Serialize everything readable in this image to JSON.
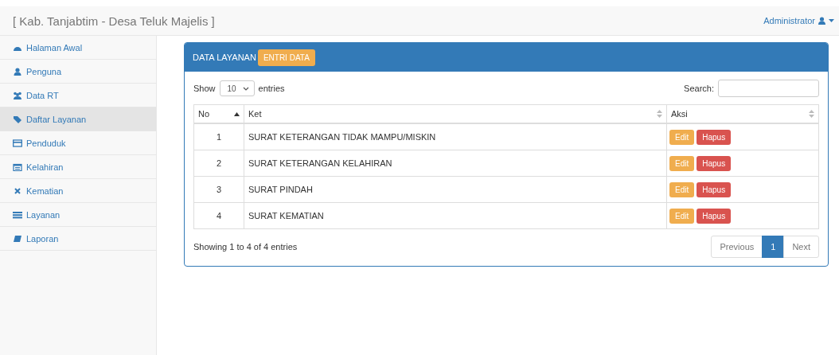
{
  "brand": "[ Kab. Tanjabtim - Desa Teluk Majelis ]",
  "user": {
    "name": "Administrator"
  },
  "sidebar": {
    "items": [
      {
        "label": "Halaman Awal",
        "selected": false
      },
      {
        "label": "Penguna",
        "selected": false
      },
      {
        "label": "Data RT",
        "selected": false
      },
      {
        "label": "Daftar Layanan",
        "selected": true
      },
      {
        "label": "Penduduk",
        "selected": false
      },
      {
        "label": "Kelahiran",
        "selected": false
      },
      {
        "label": "Kematian",
        "selected": false
      },
      {
        "label": "Layanan",
        "selected": false
      },
      {
        "label": "Laporan",
        "selected": false
      }
    ]
  },
  "panel": {
    "title": "DATA LAYANAN",
    "add_button": "ENTRI DATA",
    "length": {
      "show": "Show",
      "value": "10",
      "suffix": "entries"
    },
    "search": {
      "label": "Search:"
    },
    "table": {
      "columns": [
        {
          "label": "No",
          "sorted": true
        },
        {
          "label": "Ket",
          "sorted": false
        },
        {
          "label": "Aksi",
          "sorted": false
        }
      ],
      "rows": [
        {
          "no": "1",
          "ket": "SURAT KETERANGAN TIDAK MAMPU/MISKIN",
          "edit": "Edit",
          "delete": "Hapus"
        },
        {
          "no": "2",
          "ket": "SURAT KETERANGAN KELAHIRAN",
          "edit": "Edit",
          "delete": "Hapus"
        },
        {
          "no": "3",
          "ket": "SURAT PINDAH",
          "edit": "Edit",
          "delete": "Hapus"
        },
        {
          "no": "4",
          "ket": "SURAT KEMATIAN",
          "edit": "Edit",
          "delete": "Hapus"
        }
      ]
    },
    "info": "Showing 1 to 4 of 4 entries",
    "pagination": {
      "previous": "Previous",
      "pages": [
        {
          "label": "1",
          "selected": true
        }
      ],
      "next": "Next"
    }
  }
}
